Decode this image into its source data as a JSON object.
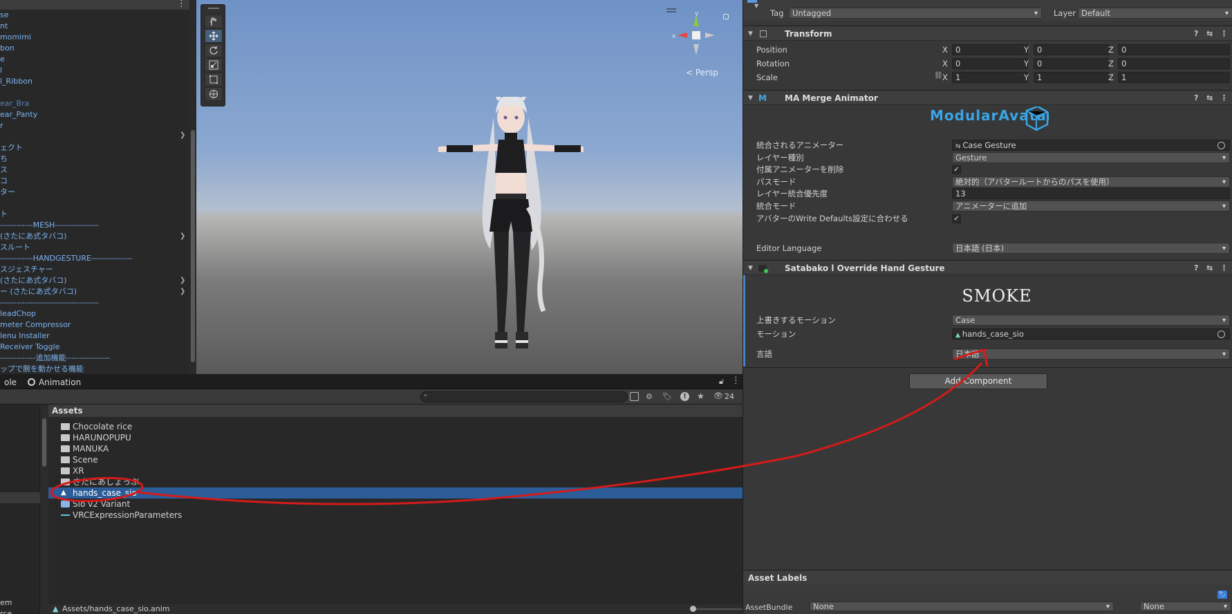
{
  "hierarchy": {
    "rows": [
      {
        "label": "se",
        "dim": false
      },
      {
        "label": "nt",
        "dim": false
      },
      {
        "label": "momimi",
        "dim": false
      },
      {
        "label": "bon",
        "dim": false
      },
      {
        "label": "e",
        "dim": false
      },
      {
        "label": "l",
        "dim": false
      },
      {
        "label": "l_Ribbon",
        "dim": false
      },
      {
        "label": "",
        "dim": false
      },
      {
        "label": "ear_Bra",
        "dim": true
      },
      {
        "label": "ear_Panty",
        "dim": false
      },
      {
        "label": "r",
        "dim": false
      },
      {
        "label": "",
        "dim": false
      },
      {
        "label": "ェクト",
        "dim": false
      },
      {
        "label": "ち",
        "dim": false
      },
      {
        "label": "ス",
        "dim": false
      },
      {
        "label": "コ",
        "dim": false
      },
      {
        "label": "ター",
        "dim": false
      },
      {
        "label": "",
        "dim": false
      },
      {
        "label": "ト",
        "dim": false
      },
      {
        "label": "------------MESH----------------",
        "dim": false
      },
      {
        "label": "(さたにあ式タバコ)",
        "dim": false
      },
      {
        "label": "スルート",
        "dim": false
      },
      {
        "label": "------------HANDGESTURE---------------",
        "dim": false
      },
      {
        "label": "スジェスチャー",
        "dim": false
      },
      {
        "label": "(さたにあ式タバコ)",
        "dim": false
      },
      {
        "label": "ー (さたにあ式タバコ)",
        "dim": false
      },
      {
        "label": "------------------------------------",
        "dim": false
      },
      {
        "label": "leadChop",
        "dim": false
      },
      {
        "label": "meter Compressor",
        "dim": false
      },
      {
        "label": "lenu Installer",
        "dim": false
      },
      {
        "label": " Receiver Toggle",
        "dim": false
      },
      {
        "label": "-------------追加機能----------------",
        "dim": false
      },
      {
        "label": "ップで腕を動かせる機能",
        "dim": false
      }
    ],
    "menu_dots": "⋮"
  },
  "scene": {
    "persp_label": "< Persp",
    "gizmo": {
      "y": "y",
      "x": "x"
    }
  },
  "project": {
    "tabs": [
      {
        "label": "ole"
      },
      {
        "label": "Animation"
      }
    ],
    "hidden_count": "24",
    "assets_header": "Assets",
    "items": [
      {
        "label": "Chocolate rice",
        "type": "folder"
      },
      {
        "label": "HARUNOPUPU",
        "type": "folder"
      },
      {
        "label": "MANUKA",
        "type": "folder"
      },
      {
        "label": "Scene",
        "type": "folder"
      },
      {
        "label": "XR",
        "type": "folder"
      },
      {
        "label": "さたにあしょっぷ",
        "type": "folder"
      },
      {
        "label": "hands_case_sio",
        "type": "anim",
        "selected": true
      },
      {
        "label": "Sio v2 Variant",
        "type": "prefab"
      },
      {
        "label": "VRCExpressionParameters",
        "type": "params"
      }
    ],
    "left_items": [
      "em",
      "rce"
    ],
    "path": "Assets/hands_case_sio.anim"
  },
  "inspector": {
    "tag_label": "Tag",
    "tag_value": "Untagged",
    "layer_label": "Layer",
    "layer_value": "Default",
    "transform": {
      "title": "Transform",
      "rows": [
        {
          "label": "Position",
          "x": "0",
          "y": "0",
          "z": "0"
        },
        {
          "label": "Rotation",
          "x": "0",
          "y": "0",
          "z": "0"
        },
        {
          "label": "Scale",
          "x": "1",
          "y": "1",
          "z": "1"
        }
      ],
      "axis": [
        "X",
        "Y",
        "Z"
      ]
    },
    "merge": {
      "title": "MA Merge Animator",
      "logo": "ModularAvatar",
      "rows": [
        {
          "label": "統合されるアニメーター",
          "value": "Case Gesture",
          "kind": "object"
        },
        {
          "label": "レイヤー種別",
          "value": "Gesture",
          "kind": "drop"
        },
        {
          "label": "付属アニメーターを削除",
          "value": "✓",
          "kind": "check"
        },
        {
          "label": "パスモード",
          "value": "絶対的（アバタールートからのパスを使用）",
          "kind": "drop"
        },
        {
          "label": "レイヤー統合優先度",
          "value": "13",
          "kind": "text"
        },
        {
          "label": "統合モード",
          "value": "アニメーターに追加",
          "kind": "drop"
        },
        {
          "label": "アバターのWrite Defaults設定に合わせる",
          "value": "✓",
          "kind": "check"
        }
      ],
      "editor_language_label": "Editor Language",
      "editor_language_value": "日本語 (日本)"
    },
    "override": {
      "title": "Satabako l Override Hand Gesture",
      "logo": "SMOKE",
      "rows": [
        {
          "label": "上書きするモーション",
          "value": "Case",
          "kind": "drop"
        },
        {
          "label": "モーション",
          "value": "hands_case_sio",
          "kind": "object"
        }
      ],
      "lang_label": "言語",
      "lang_value": "日本語"
    },
    "add_component": "Add Component",
    "asset_labels": "Asset Labels",
    "assetbundle_label": "AssetBundle",
    "assetbundle_value": "None",
    "assetbundle_variant": "None"
  },
  "annotation_color": "#d61a1a"
}
